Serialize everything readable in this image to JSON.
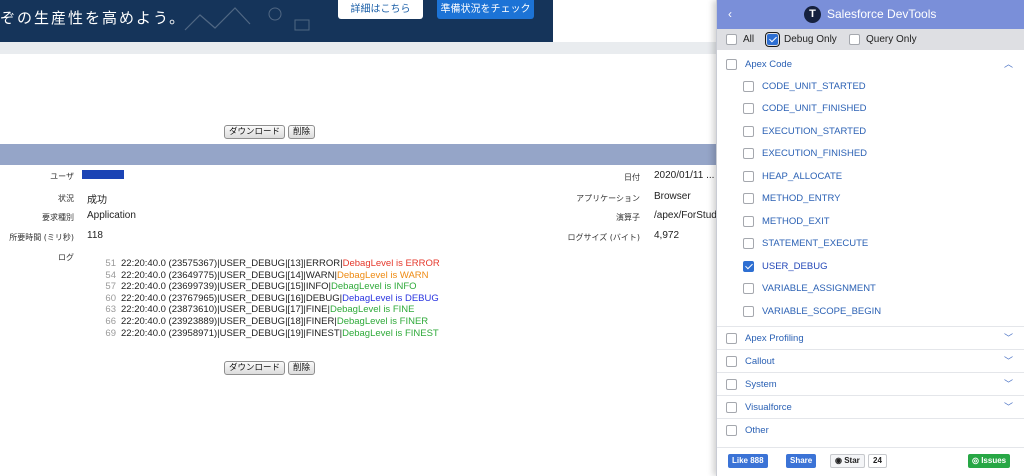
{
  "banner": {
    "text": "ぞの生産性を高めよう。",
    "details_button": "詳細はこちら",
    "check_button": "準備状況をチェック"
  },
  "log_page": {
    "download_label": "ダウンロード",
    "delete_label": "削除",
    "left_fields": [
      {
        "label": "ユーザ",
        "value": ""
      },
      {
        "label": "状況",
        "value": "成功"
      },
      {
        "label": "要求種別",
        "value": "Application"
      },
      {
        "label": "所要時間 (ミリ秒)",
        "value": "118"
      },
      {
        "label": "ログ",
        "value": ""
      }
    ],
    "right_fields": [
      {
        "label": "日付",
        "value": "2020/01/11 ..."
      },
      {
        "label": "アプリケーション",
        "value": "Browser"
      },
      {
        "label": "演算子",
        "value": "/apex/ForStud"
      },
      {
        "label": "ログサイズ (バイト)",
        "value": "4,972"
      }
    ],
    "log_lines": [
      {
        "num": "51",
        "prefix": "22:20:40.0 (23575367)|USER_DEBUG|[13]|ERROR|",
        "msg": "DebagLevel is ERROR",
        "color": "#e5392d"
      },
      {
        "num": "54",
        "prefix": "22:20:40.0 (23649775)|USER_DEBUG|[14]|WARN|",
        "msg": "DebagLevel is WARN",
        "color": "#ee8a12"
      },
      {
        "num": "57",
        "prefix": "22:20:40.0 (23699739)|USER_DEBUG|[15]|INFO|",
        "msg": "DebagLevel is INFO",
        "color": "#2faa3a"
      },
      {
        "num": "60",
        "prefix": "22:20:40.0 (23767965)|USER_DEBUG|[16]|DEBUG|",
        "msg": "DebagLevel is DEBUG",
        "color": "#2a35e0"
      },
      {
        "num": "63",
        "prefix": "22:20:40.0 (23873610)|USER_DEBUG|[17]|FINE|",
        "msg": "DebagLevel is FINE",
        "color": "#2faa3a"
      },
      {
        "num": "66",
        "prefix": "22:20:40.0 (23923889)|USER_DEBUG|[18]|FINER|",
        "msg": "DebagLevel is FINER",
        "color": "#2faa3a"
      },
      {
        "num": "69",
        "prefix": "22:20:40.0 (23958971)|USER_DEBUG|[19]|FINEST|",
        "msg": "DebagLevel is FINEST",
        "color": "#2faa3a"
      }
    ]
  },
  "devtools": {
    "title": "Salesforce DevTools",
    "back_icon": "‹",
    "logo_glyph": "T",
    "filters": {
      "all": "All",
      "debug_only": "Debug Only",
      "query_only": "Query Only",
      "debug_only_checked": true
    },
    "apex_code": {
      "label": "Apex Code",
      "items": [
        {
          "label": "CODE_UNIT_STARTED",
          "checked": false
        },
        {
          "label": "CODE_UNIT_FINISHED",
          "checked": false
        },
        {
          "label": "EXECUTION_STARTED",
          "checked": false
        },
        {
          "label": "EXECUTION_FINISHED",
          "checked": false
        },
        {
          "label": "HEAP_ALLOCATE",
          "checked": false
        },
        {
          "label": "METHOD_ENTRY",
          "checked": false
        },
        {
          "label": "METHOD_EXIT",
          "checked": false
        },
        {
          "label": "STATEMENT_EXECUTE",
          "checked": false
        },
        {
          "label": "USER_DEBUG",
          "checked": true
        },
        {
          "label": "VARIABLE_ASSIGNMENT",
          "checked": false
        },
        {
          "label": "VARIABLE_SCOPE_BEGIN",
          "checked": false
        }
      ]
    },
    "categories": [
      {
        "label": "Apex Profiling",
        "expandable": true
      },
      {
        "label": "Callout",
        "expandable": true
      },
      {
        "label": "System",
        "expandable": true
      },
      {
        "label": "Visualforce",
        "expandable": true
      },
      {
        "label": "Other",
        "expandable": false
      }
    ],
    "footer": {
      "like": "Like 888",
      "share": "Share",
      "star": "Star",
      "star_count": "24",
      "issues": "Issues"
    }
  }
}
